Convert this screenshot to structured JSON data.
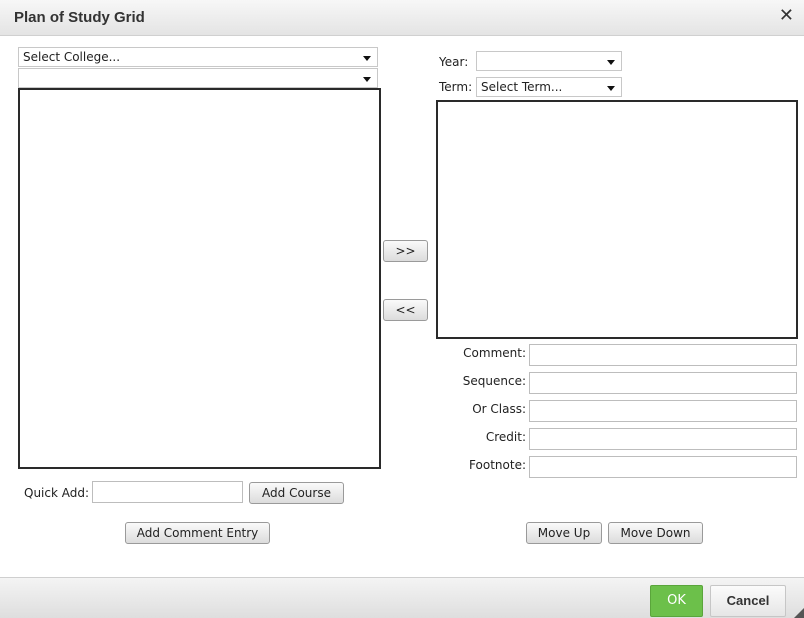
{
  "dialog": {
    "title": "Plan of Study Grid",
    "close_icon": "close-icon"
  },
  "left": {
    "college_select": "Select College...",
    "second_select": "",
    "quick_add_label": "Quick Add:",
    "quick_add_value": "",
    "add_course_label": "Add Course",
    "add_comment_label": "Add Comment Entry"
  },
  "middle": {
    "move_right_label": ">>",
    "move_left_label": "<<"
  },
  "right": {
    "year_label": "Year:",
    "year_value": "",
    "term_label": "Term:",
    "term_value": "Select Term...",
    "fields": {
      "comment_label": "Comment:",
      "sequence_label": "Sequence:",
      "or_class_label": "Or Class:",
      "credit_label": "Credit:",
      "footnote_label": "Footnote:"
    },
    "move_up_label": "Move Up",
    "move_down_label": "Move Down"
  },
  "footer": {
    "ok_label": "OK",
    "cancel_label": "Cancel"
  },
  "colors": {
    "ok_button": "#6cc04a",
    "listbox_border": "#2a2a2a"
  }
}
